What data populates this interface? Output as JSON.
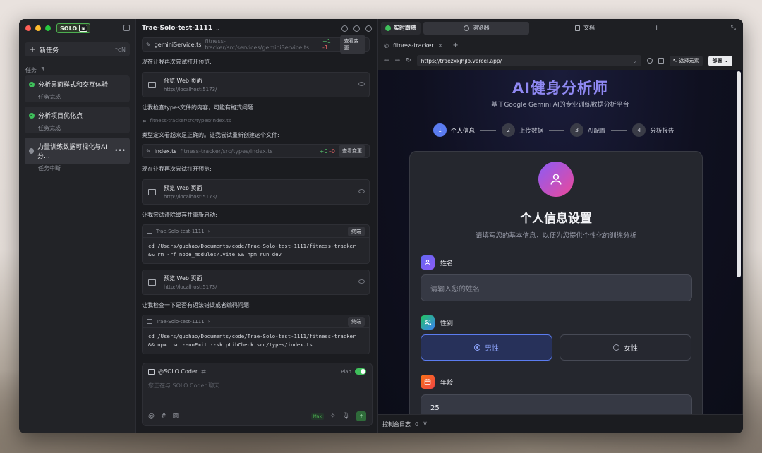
{
  "sidebar": {
    "logo_text": "SOLO",
    "new_task_label": "新任务",
    "new_task_shortcut": "⌥N",
    "tasks_label": "任务",
    "tasks_count": "3",
    "tasks": [
      {
        "title": "分析界面样式和交互体验",
        "status": "任务完成"
      },
      {
        "title": "分析项目优化点",
        "status": "任务完成"
      },
      {
        "title": "力量训练数据可视化与AI分...",
        "status": "任务中断"
      }
    ]
  },
  "chat": {
    "title": "Trae-Solo-test-1111",
    "file1": {
      "name": "geminiService.ts",
      "path": "fitness-tracker/src/services/geminiService.ts",
      "plus": "+1",
      "minus": "-1",
      "button": "查看变更"
    },
    "msg1": "现在让我再次尝试打开预览:",
    "preview_title": "预览 Web 页面",
    "preview_url": "http://localhost:5173/",
    "msg2": "让我检查types文件的内容，可能有格式问题:",
    "ref_path": "fitness-tracker/src/types/index.ts",
    "msg3": "类型定义看起来是正确的。让我尝试重新创建这个文件:",
    "file2": {
      "name": "index.ts",
      "path": "fitness-tracker/src/types/index.ts",
      "plus": "+0",
      "minus": "-0",
      "button": "查看变更"
    },
    "msg4": "现在让我再次尝试打开预览:",
    "msg5": "让我尝试清除缓存并重新启动:",
    "term_label": "Trae-Solo-test-1111",
    "term_button": "终端",
    "term1": "cd /Users/guohao/Documents/code/Trae-Solo-test-1111/fitness-tracker\n&& rm -rf node_modules/.vite && npm run dev",
    "msg6": "让我检查一下是否有语法错误或者编码问题:",
    "term2": "cd /Users/guohao/Documents/code/Trae-Solo-test-1111/fitness-tracker\n&& npx tsc --noEmit --skipLibCheck src/types/index.ts",
    "input": {
      "agent": "@SOLO Coder",
      "plan_label": "Plan",
      "placeholder": "您正在与 SOLO Coder 聊天",
      "max_label": "Max"
    }
  },
  "browser": {
    "live_tab": "实时跟随",
    "tab_browser": "浏览器",
    "tab_docs": "文档",
    "page_tab": "fitness-tracker",
    "url": "https://traezxkjhjlo.vercel.app/",
    "select_element": "选择元素",
    "deploy": "部署",
    "console_label": "控制台日志",
    "console_count": "0"
  },
  "app": {
    "title": "AI健身分析师",
    "subtitle": "基于Google Gemini AI的专业训练数据分析平台",
    "steps": [
      {
        "num": "1",
        "label": "个人信息"
      },
      {
        "num": "2",
        "label": "上传数据"
      },
      {
        "num": "3",
        "label": "AI配置"
      },
      {
        "num": "4",
        "label": "分析报告"
      }
    ],
    "card_title": "个人信息设置",
    "card_subtitle": "请填写您的基本信息，以便为您提供个性化的训练分析",
    "name_label": "姓名",
    "name_placeholder": "请输入您的姓名",
    "gender_label": "性别",
    "gender_male": "男性",
    "gender_female": "女性",
    "age_label": "年龄",
    "age_value": "25"
  }
}
